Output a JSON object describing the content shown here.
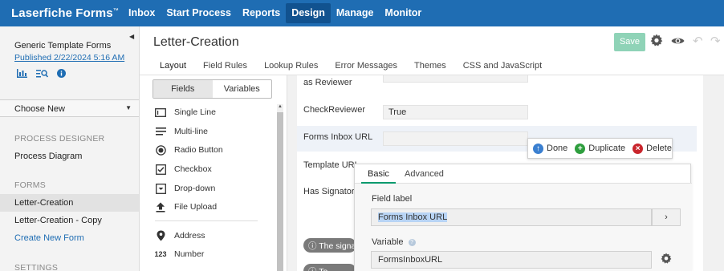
{
  "app": {
    "brand": "Laserfiche Forms",
    "trademark": "™"
  },
  "topnav": {
    "items": [
      "Inbox",
      "Start Process",
      "Reports",
      "Design",
      "Manage",
      "Monitor"
    ],
    "active_index": 3
  },
  "sidebar": {
    "form_name": "Generic Template Forms",
    "published": "Published 2/22/2024 5:16 AM",
    "choose_new": "Choose New",
    "process_designer_heading": "PROCESS DESIGNER",
    "process_diagram": "Process Diagram",
    "forms_heading": "FORMS",
    "form_items": [
      "Letter-Creation",
      "Letter-Creation - Copy"
    ],
    "create_new_form": "Create New Form",
    "settings_heading": "SETTINGS"
  },
  "header": {
    "title": "Letter-Creation",
    "save_label": "Save"
  },
  "tabs": [
    "Layout",
    "Field Rules",
    "Lookup Rules",
    "Error Messages",
    "Themes",
    "CSS and JavaScript"
  ],
  "fields_panel": {
    "segment": [
      "Fields",
      "Variables"
    ],
    "items": [
      "Single Line",
      "Multi-line",
      "Radio Button",
      "Checkbox",
      "Drop-down",
      "File Upload"
    ],
    "items2": [
      "Address",
      "Number"
    ]
  },
  "form": {
    "row0_label": "as Reviewer",
    "check_reviewer_label": "CheckReviewer",
    "check_reviewer_value": "True",
    "forms_inbox_label": "Forms Inbox URL",
    "template_url_label": "Template URL",
    "has_signatory_label": "Has Signatory",
    "pill1": "The signa",
    "pill2": "To"
  },
  "actions": {
    "done": "Done",
    "duplicate": "Duplicate",
    "delete": "Delete"
  },
  "props": {
    "tabs": [
      "Basic",
      "Advanced"
    ],
    "field_label_title": "Field label",
    "field_label_value": "Forms Inbox URL",
    "variable_title": "Variable",
    "variable_value": "FormsInboxURL"
  }
}
